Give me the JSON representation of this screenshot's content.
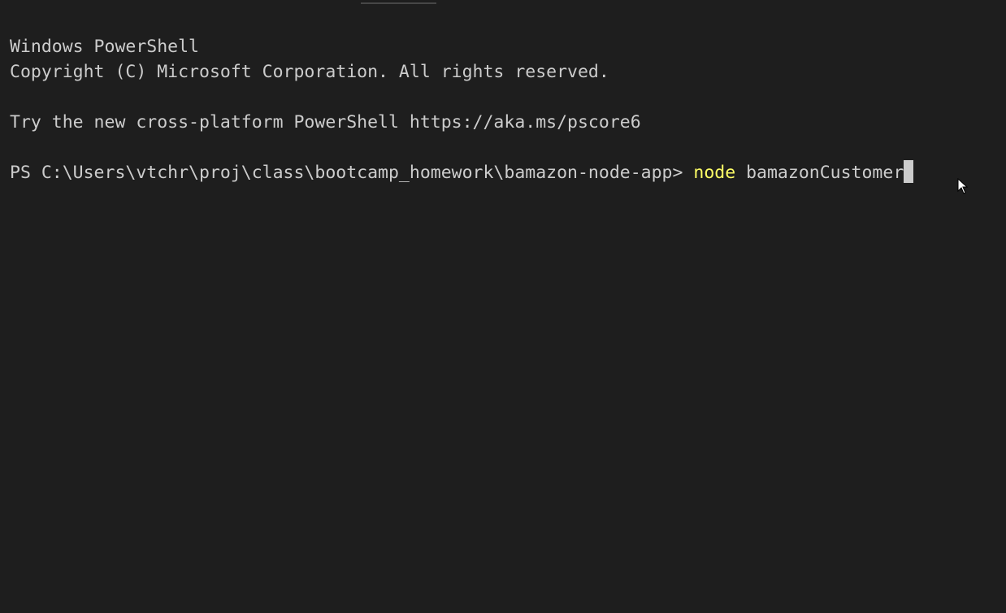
{
  "terminal": {
    "header_line1": "Windows PowerShell",
    "header_line2": "Copyright (C) Microsoft Corporation. All rights reserved.",
    "tip_line": "Try the new cross-platform PowerShell https://aka.ms/pscore6",
    "prompt": "PS C:\\Users\\vtchr\\proj\\class\\bootcamp_homework\\bamazon-node-app> ",
    "command_keyword": "node",
    "command_args": " bamazonCustomer"
  },
  "colors": {
    "background": "#1e1e1e",
    "foreground": "#cccccc",
    "command_keyword": "#ffff66"
  }
}
